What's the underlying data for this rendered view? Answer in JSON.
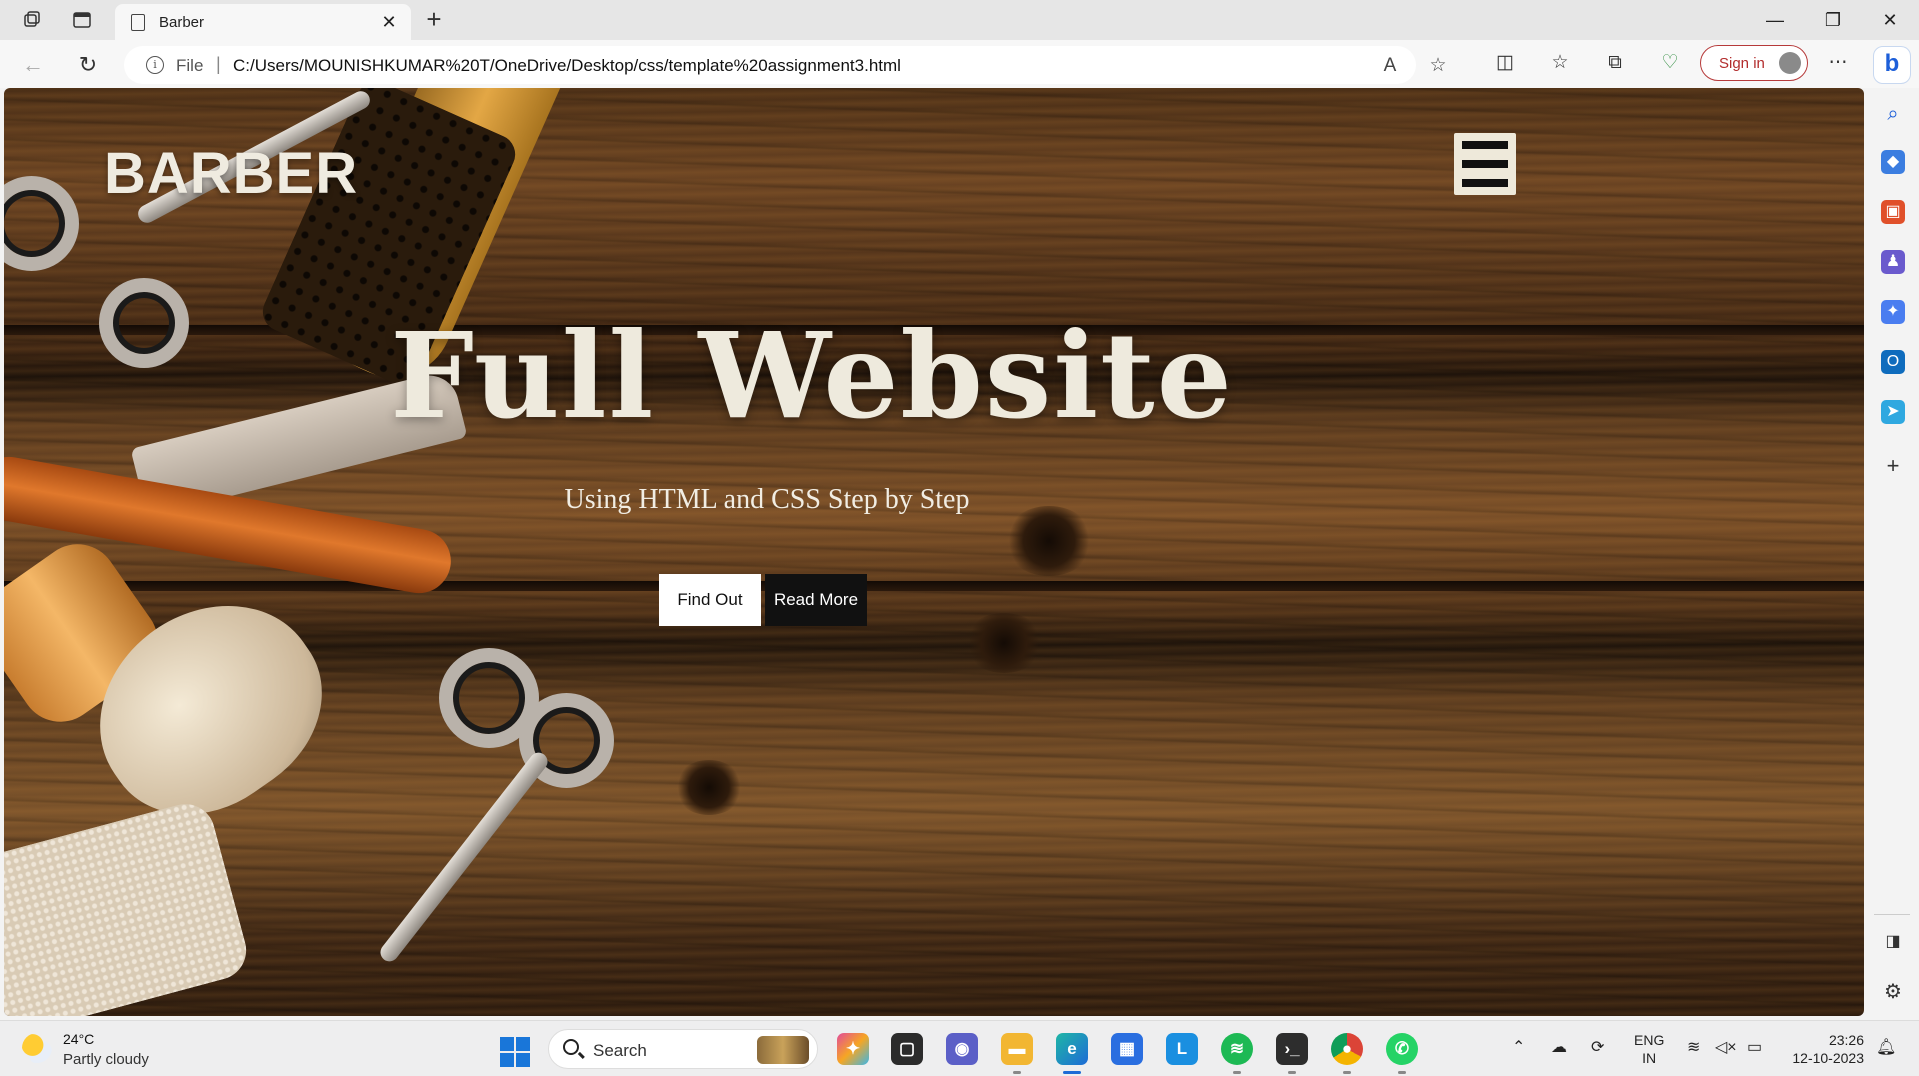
{
  "browser": {
    "tab_title": "Barber",
    "address_scheme": "File",
    "address_url": "C:/Users/MOUNISHKUMAR%20T/OneDrive/Desktop/css/template%20assignment3.html",
    "sign_in_label": "Sign in"
  },
  "page": {
    "brand": "BARBER",
    "hero_title": "Full Website",
    "hero_subtitle": "Using HTML and CSS Step by Step",
    "buttons": {
      "find_out": "Find Out",
      "read_more": "Read More"
    }
  },
  "taskbar": {
    "weather_temp": "24°C",
    "weather_condition": "Partly cloudy",
    "search_label": "Search",
    "language_line1": "ENG",
    "language_line2": "IN",
    "time": "23:26",
    "date": "12-10-2023"
  },
  "colors": {
    "hero_text": "#eeeadd",
    "menu_button_bg": "#eee9da",
    "find_out_bg": "#ffffff",
    "read_more_bg": "#111111",
    "sign_in_accent": "#b22c2c"
  }
}
